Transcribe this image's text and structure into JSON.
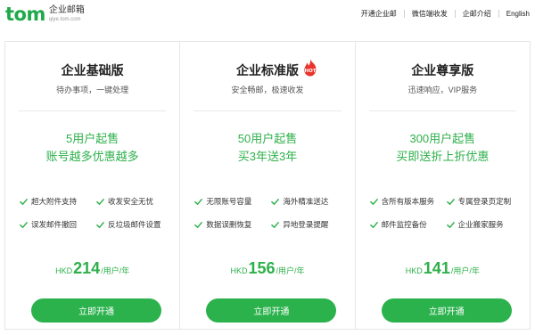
{
  "header": {
    "logo_text": "tom",
    "logo_cn": "企业邮箱",
    "logo_url": "qiye.tom.com",
    "nav": [
      "开通企业邮",
      "微信端收发",
      "企邮介绍",
      "English"
    ]
  },
  "plans": [
    {
      "title": "企业基础版",
      "subtitle": "待办事项，一键处理",
      "promo_line1": "5用户起售",
      "promo_line2": "账号越多优惠越多",
      "features": [
        "超大附件支持",
        "收发安全无忧",
        "误发邮件撤回",
        "反垃圾邮件设置"
      ],
      "currency": "HKD",
      "price": "214",
      "unit": "/用户/年",
      "button": "立即开通"
    },
    {
      "title": "企业标准版",
      "badge": "HOT",
      "subtitle": "安全畅邮，极速收发",
      "promo_line1": "50用户起售",
      "promo_line2": "买3年送3年",
      "features": [
        "无限账号容量",
        "海外精准送达",
        "数据误删恢复",
        "异地登录提醒"
      ],
      "currency": "HKD",
      "price": "156",
      "unit": "/用户/年",
      "button": "立即开通"
    },
    {
      "title": "企业尊享版",
      "subtitle": "迅速响应，VIP服务",
      "promo_line1": "300用户起售",
      "promo_line2": "买即送折上折优惠",
      "features": [
        "含所有版本服务",
        "专属登录页定制",
        "邮件监控备份",
        "企业搬家服务"
      ],
      "currency": "HKD",
      "price": "141",
      "unit": "/用户/年",
      "button": "立即开通"
    }
  ],
  "colors": {
    "brand_green": "#1fa94a",
    "accent_green": "#2db04a",
    "button_green": "#2bb24c",
    "hot_red": "#e8342b"
  },
  "icons": {
    "feature": "check-icon",
    "badge": "hot-flame-icon"
  }
}
